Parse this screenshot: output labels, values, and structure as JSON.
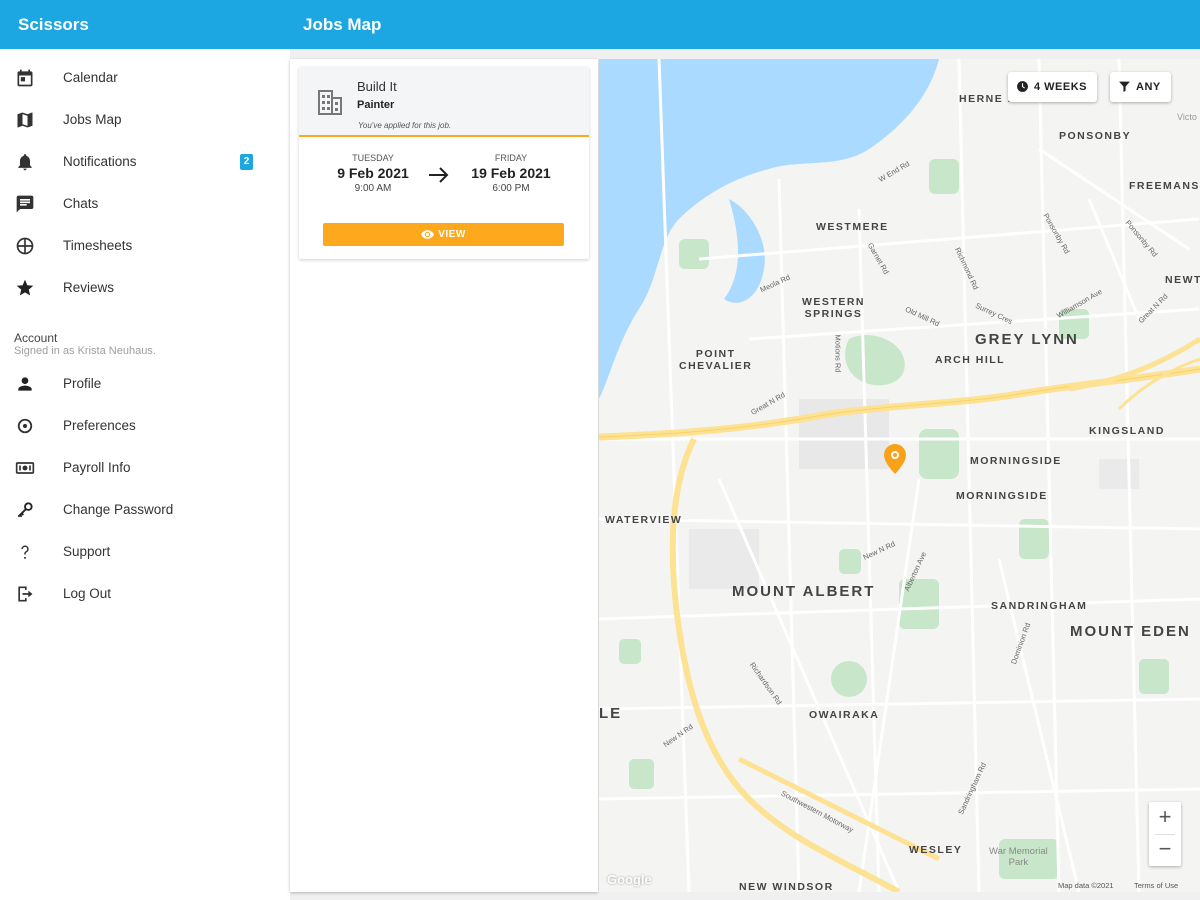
{
  "appbar": {
    "app_name": "Scissors",
    "page_title": "Jobs Map"
  },
  "sidebar": {
    "items": [
      {
        "label": "Calendar",
        "icon": "calendar-icon"
      },
      {
        "label": "Jobs Map",
        "icon": "map-icon"
      },
      {
        "label": "Notifications",
        "icon": "bell-icon",
        "badge": "2"
      },
      {
        "label": "Chats",
        "icon": "chat-icon"
      },
      {
        "label": "Timesheets",
        "icon": "timesheet-icon"
      },
      {
        "label": "Reviews",
        "icon": "star-icon"
      }
    ],
    "account": {
      "title": "Account",
      "subtitle": "Signed in as Krista Neuhaus.",
      "items": [
        {
          "label": "Profile",
          "icon": "person-icon"
        },
        {
          "label": "Preferences",
          "icon": "settings-icon"
        },
        {
          "label": "Payroll Info",
          "icon": "money-icon"
        },
        {
          "label": "Change Password",
          "icon": "key-icon"
        },
        {
          "label": "Support",
          "icon": "help-icon"
        },
        {
          "label": "Log Out",
          "icon": "logout-icon"
        }
      ]
    }
  },
  "job_card": {
    "company": "Build It",
    "role": "Painter",
    "note": "You've applied for this job.",
    "start": {
      "day": "TUESDAY",
      "date": "9 Feb 2021",
      "time": "9:00 AM"
    },
    "end": {
      "day": "FRIDAY",
      "date": "19 Feb 2021",
      "time": "6:00 PM"
    },
    "view_label": "VIEW"
  },
  "map": {
    "filters": {
      "period_label": "4 WEEKS",
      "type_label": "ANY"
    },
    "suburbs": {
      "herne_bay": "HERNE B",
      "ponsonby": "PONSONBY",
      "freemans": "FREEMANS",
      "westmere": "WESTMERE",
      "western_springs": "WESTERN\nSPRINGS",
      "point_chevalier": "POINT\nCHEVALIER",
      "grey_lynn": "GREY LYNN",
      "arch_hill": "ARCH HILL",
      "newton": "NEWT",
      "kingsland": "KINGSLAND",
      "morningside_1": "MORNINGSIDE",
      "morningside_2": "MORNINGSIDE",
      "waterview": "WATERVIEW",
      "mount_albert": "MOUNT ALBERT",
      "sandringham": "SANDRINGHAM",
      "mount_eden": "MOUNT EDEN",
      "le": "LE",
      "owairaka": "OWAIRAKA",
      "wesley": "WESLEY",
      "new_windsor": "NEW WINDSOR",
      "victo": "Victo",
      "war_memorial": "War Memorial\nPark"
    },
    "streets": {
      "w_end_rd": "W End Rd",
      "garnet_rd": "Garnet Rd",
      "richmond_rd": "Richmond Rd",
      "ponsonby_rd": "Ponsonby Rd",
      "meola_rd": "Meola Rd",
      "old_mill_rd": "Old Mill Rd",
      "surrey_cres": "Surrey Cres",
      "williamson_ave": "Williamson Ave",
      "motions_rd": "Motions Rd",
      "great_n_rd_1": "Great N Rd",
      "great_n_rd_2": "Great N Rd",
      "new_n_rd_1": "New N Rd",
      "new_n_rd_2": "New N Rd",
      "alberton_ave": "Alberton Ave",
      "richardson_rd": "Richardson Rd",
      "dominion_rd": "Dominion Rd",
      "sandringham_rd": "Sandringham Rd",
      "southwestern_mwy": "Southwestern Motorway"
    },
    "google": "Google",
    "map_data": "Map data ©2021",
    "terms": "Terms of Use",
    "zoom_in": "+",
    "zoom_out": "−"
  },
  "colors": {
    "appbar": "#1da7e2",
    "accent": "#fda81d",
    "water": "#aadaff",
    "park": "#c8e6c9",
    "motorway": "#fde293"
  }
}
